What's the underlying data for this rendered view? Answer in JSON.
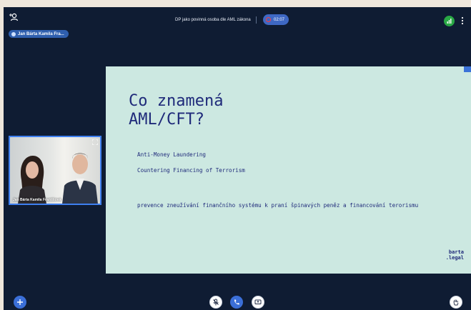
{
  "meeting": {
    "title": "DP jako povinná osoba dle AML zákona",
    "recording_time": "02:07"
  },
  "participant_chip": {
    "label": "Jan Bárta Kamila Fra..."
  },
  "video_tile": {
    "name": "Jan Bárta Kamila Františová"
  },
  "slide": {
    "heading": "Co znamená\nAML/CFT?",
    "line1": "Anti-Money Laundering",
    "line2": "Countering Financing of Terrorism",
    "paragraph": "prevence zneužívání finančního systému k praní špinavých peněz a financování terorismu",
    "brand": "barta\n.legal"
  },
  "colors": {
    "background": "#0f1c33",
    "slide_bg": "#cce8e1",
    "slide_text": "#1f2a7a",
    "accent": "#3b6fd8",
    "record": "#ff3b3b",
    "signal": "#29a845"
  },
  "icons": [
    "user-add-icon",
    "record-icon",
    "signal-icon",
    "more-vertical-icon",
    "expand-icon",
    "plus-icon",
    "mic-off-icon",
    "phone-icon",
    "screen-share-icon",
    "raise-hand-icon"
  ]
}
